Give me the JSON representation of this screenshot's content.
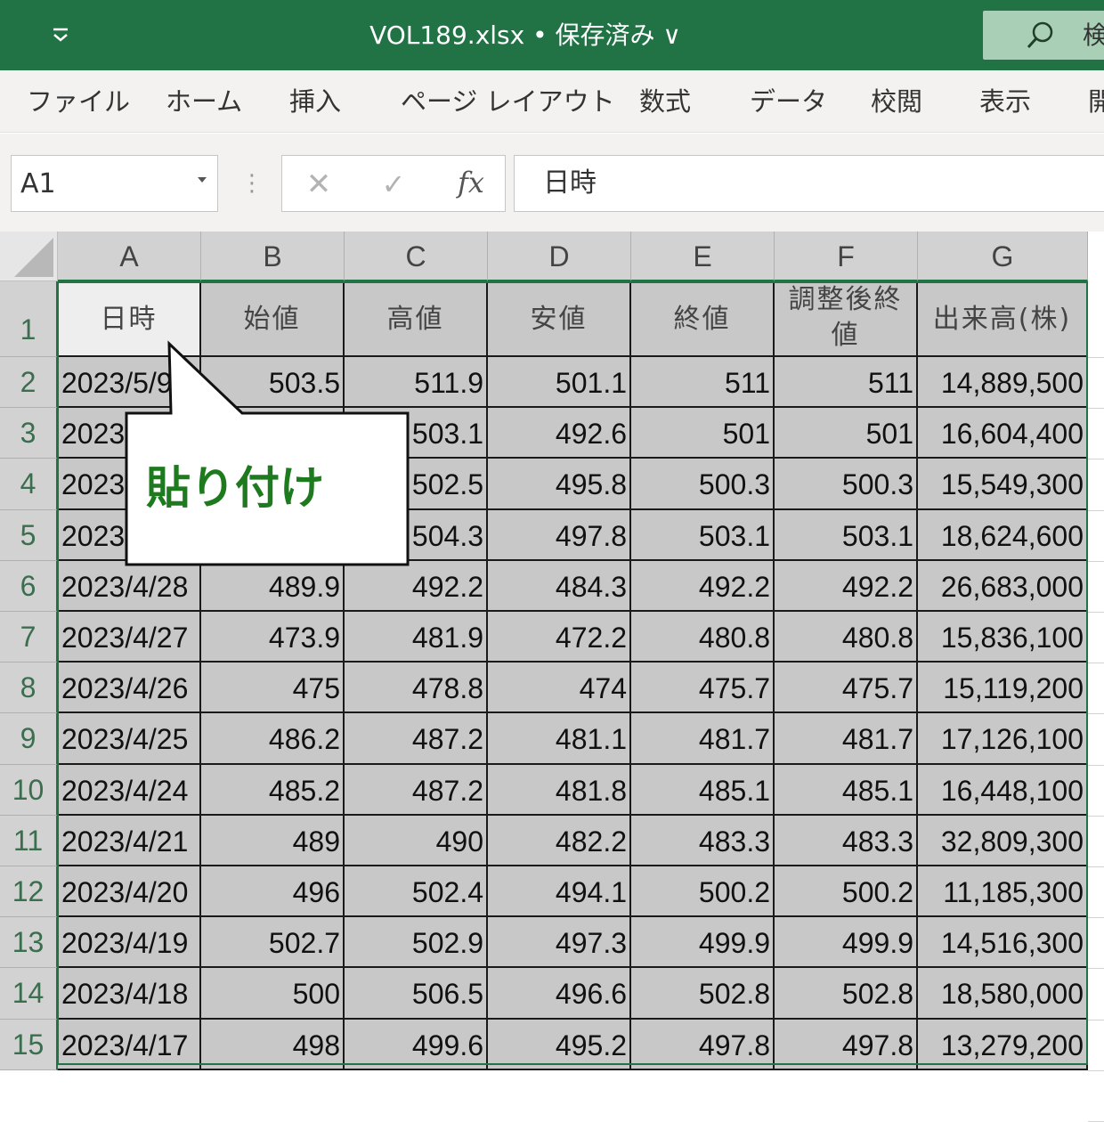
{
  "titlebar": {
    "filename": "VOL189.xlsx • 保存済み ∨",
    "search_text": "検"
  },
  "ribbon": {
    "tabs": [
      "ファイル",
      "ホーム",
      "挿入",
      "ページ レイアウト",
      "数式",
      "データ",
      "校閲",
      "表示",
      "開"
    ]
  },
  "formula_bar": {
    "name_box": "A1",
    "formula": "日時",
    "fx_label": "fx"
  },
  "grid": {
    "columns": [
      "A",
      "B",
      "C",
      "D",
      "E",
      "F",
      "G"
    ],
    "rows": [
      "1",
      "2",
      "3",
      "4",
      "5",
      "6",
      "7",
      "8",
      "9",
      "10",
      "11",
      "12",
      "13",
      "14",
      "15"
    ],
    "headers": [
      "日時",
      "始値",
      "高値",
      "安値",
      "終値",
      "調整後終値",
      "出来高(株)"
    ],
    "data": [
      [
        "2023/5/9",
        "503.5",
        "511.9",
        "501.1",
        "511",
        "511",
        "14,889,500"
      ],
      [
        "2023",
        "",
        "503.1",
        "492.6",
        "501",
        "501",
        "16,604,400"
      ],
      [
        "2023",
        "",
        "502.5",
        "495.8",
        "500.3",
        "500.3",
        "15,549,300"
      ],
      [
        "2023",
        "",
        "504.3",
        "497.8",
        "503.1",
        "503.1",
        "18,624,600"
      ],
      [
        "2023/4/28",
        "489.9",
        "492.2",
        "484.3",
        "492.2",
        "492.2",
        "26,683,000"
      ],
      [
        "2023/4/27",
        "473.9",
        "481.9",
        "472.2",
        "480.8",
        "480.8",
        "15,836,100"
      ],
      [
        "2023/4/26",
        "475",
        "478.8",
        "474",
        "475.7",
        "475.7",
        "15,119,200"
      ],
      [
        "2023/4/25",
        "486.2",
        "487.2",
        "481.1",
        "481.7",
        "481.7",
        "17,126,100"
      ],
      [
        "2023/4/24",
        "485.2",
        "487.2",
        "481.8",
        "485.1",
        "485.1",
        "16,448,100"
      ],
      [
        "2023/4/21",
        "489",
        "490",
        "482.2",
        "483.3",
        "483.3",
        "32,809,300"
      ],
      [
        "2023/4/20",
        "496",
        "502.4",
        "494.1",
        "500.2",
        "500.2",
        "11,185,300"
      ],
      [
        "2023/4/19",
        "502.7",
        "502.9",
        "497.3",
        "499.9",
        "499.9",
        "14,516,300"
      ],
      [
        "2023/4/18",
        "500",
        "506.5",
        "496.6",
        "502.8",
        "502.8",
        "18,580,000"
      ],
      [
        "2023/4/17",
        "498",
        "499.6",
        "495.2",
        "497.8",
        "497.8",
        "13,279,200"
      ]
    ]
  },
  "callout": {
    "text": "貼り付け",
    "text_color": "#1e7a1e"
  },
  "colors": {
    "title_bar": "#217346",
    "selected_cells": "#c8c8c8",
    "selection_border": "#217346"
  }
}
